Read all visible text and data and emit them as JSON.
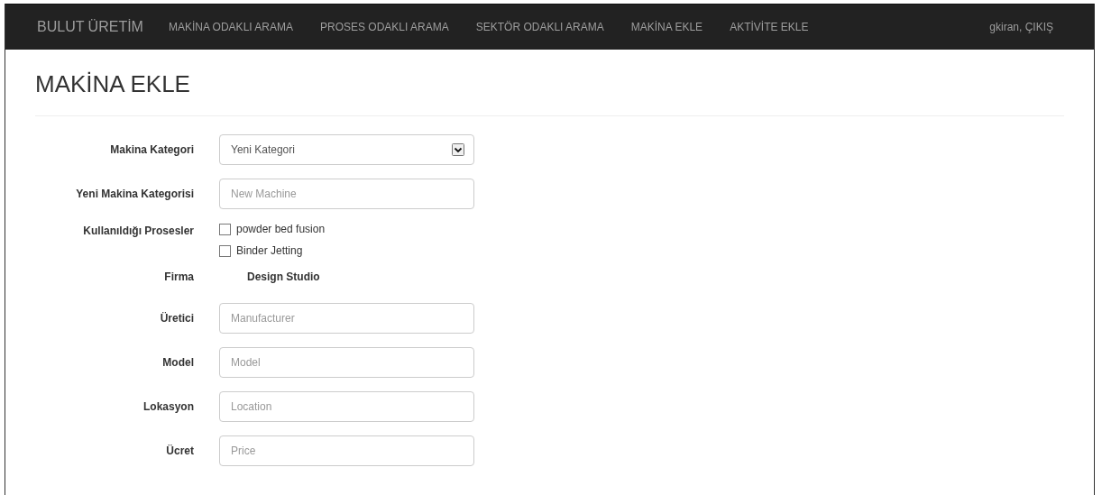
{
  "navbar": {
    "brand": "BULUT ÜRETİM",
    "links": [
      "MAKİNA ODAKLI ARAMA",
      "PROSES ODAKLI ARAMA",
      "SEKTÖR ODAKLI ARAMA",
      "MAKİNA EKLE",
      "AKTİVİTE EKLE"
    ],
    "user": "gkiran, ÇIKIŞ"
  },
  "page_title": "MAKİNA EKLE",
  "form": {
    "rows": [
      {
        "kind": "select",
        "label": "Makina Kategori",
        "value": "Yeni Kategori"
      },
      {
        "kind": "input",
        "label": "Yeni Makina Kategorisi",
        "placeholder": "New Machine"
      },
      {
        "kind": "checkboxes",
        "label": "Kullanıldığı Prosesler",
        "options": [
          {
            "label": "powder bed fusion",
            "checked": false
          },
          {
            "label": "Binder Jetting",
            "checked": false
          }
        ]
      },
      {
        "kind": "static",
        "label": "Firma",
        "value": "Design Studio"
      },
      {
        "kind": "input",
        "label": "Üretici",
        "placeholder": "Manufacturer"
      },
      {
        "kind": "input",
        "label": "Model",
        "placeholder": "Model"
      },
      {
        "kind": "input",
        "label": "Lokasyon",
        "placeholder": "Location"
      },
      {
        "kind": "input",
        "label": "Ücret",
        "placeholder": "Price"
      }
    ]
  }
}
